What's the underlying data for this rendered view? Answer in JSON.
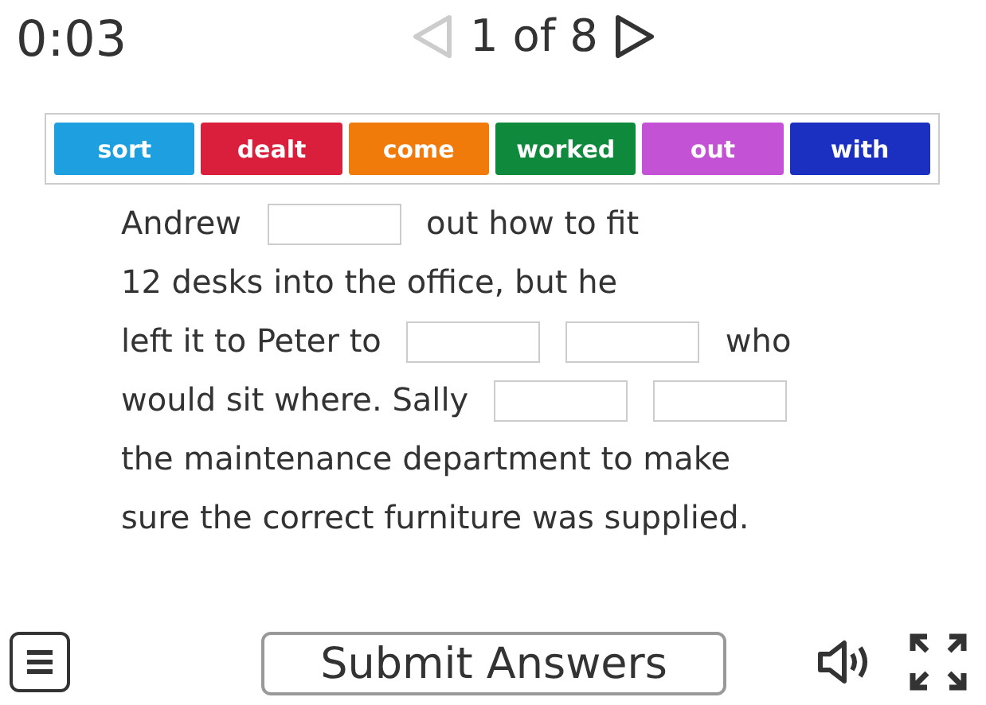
{
  "timer": "0:03",
  "pager": {
    "prev_disabled": true,
    "label": "1 of 8",
    "next_disabled": false
  },
  "tiles": [
    {
      "label": "sort",
      "color": "#1e9fe0"
    },
    {
      "label": "dealt",
      "color": "#da1f3c"
    },
    {
      "label": "come",
      "color": "#f07a0a"
    },
    {
      "label": "worked",
      "color": "#0f8a3c"
    },
    {
      "label": "out",
      "color": "#c452d4"
    },
    {
      "label": "with",
      "color": "#1b2fc0"
    }
  ],
  "passage": [
    [
      {
        "kind": "text",
        "text": "Andrew"
      },
      {
        "kind": "blank"
      },
      {
        "kind": "text",
        "text": "out how to fit"
      }
    ],
    [
      {
        "kind": "text",
        "text": "12 desks into the office, but he"
      }
    ],
    [
      {
        "kind": "text",
        "text": "left it to Peter to"
      },
      {
        "kind": "blank"
      },
      {
        "kind": "blank"
      },
      {
        "kind": "text",
        "text": "who"
      }
    ],
    [
      {
        "kind": "text",
        "text": "would sit where. Sally"
      },
      {
        "kind": "blank"
      },
      {
        "kind": "blank"
      }
    ],
    [
      {
        "kind": "text",
        "text": "the maintenance department to make"
      }
    ],
    [
      {
        "kind": "text",
        "text": "sure the correct furniture was supplied."
      }
    ]
  ],
  "submit": "Submit Answers"
}
